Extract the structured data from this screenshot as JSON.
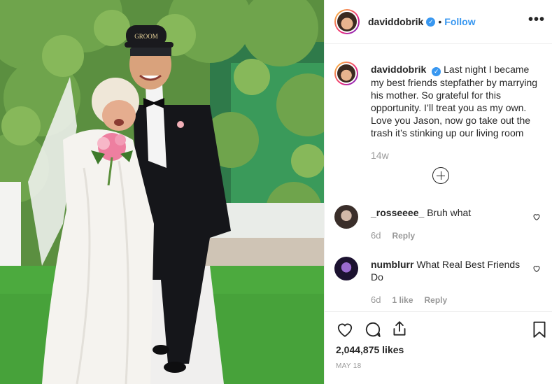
{
  "post": {
    "username": "daviddobrik",
    "verified": true,
    "separator": "•",
    "follow_label": "Follow",
    "more_label": "•••",
    "caption": {
      "username": "daviddobrik",
      "text": "Last night I became my best friends stepfather by marrying his mother. So grateful for this opportunity. I’ll treat you as my own. Love you Jason, now go take out the trash it’s stinking up our living room",
      "time": "14w"
    },
    "comments": [
      {
        "username": "_rosseeee_",
        "text": "Bruh what",
        "time": "6d",
        "likes": "",
        "reply_label": "Reply"
      },
      {
        "username": "numblurr",
        "text": "What Real Best Friends Do",
        "time": "6d",
        "likes": "1 like",
        "reply_label": "Reply"
      }
    ],
    "likes_count": "2,044,875 likes",
    "date": "MAY 18",
    "hat_text": "GROOM",
    "icons": {
      "like": "heart-icon",
      "comment": "comment-icon",
      "share": "share-icon",
      "save": "bookmark-icon",
      "load_more": "plus-circle-icon"
    },
    "colors": {
      "accent": "#3897f0",
      "muted": "#999999",
      "text": "#262626"
    }
  }
}
